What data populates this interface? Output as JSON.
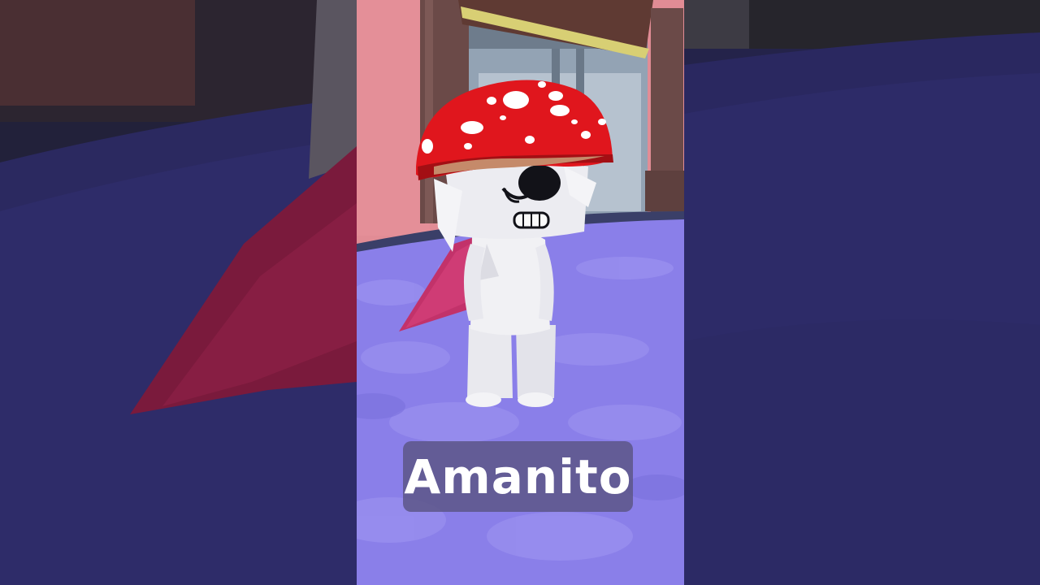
{
  "video": {
    "caption": "Amanito",
    "layout": "vertical-short-with-blurred-side-panels"
  },
  "scene": {
    "character": {
      "icon": "mushroom-hat-avatar-icon"
    },
    "floor_color": "#8b7fe8",
    "wall_color": "#e8949c",
    "hat_color": "#e0161d"
  }
}
